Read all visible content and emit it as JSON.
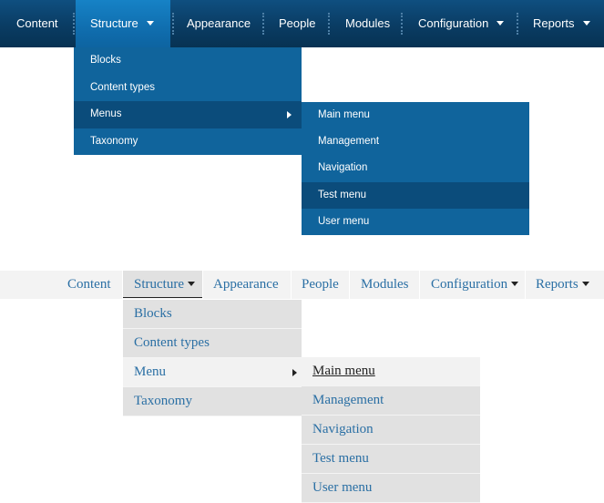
{
  "colors": {
    "top_bar": "#0a3c63",
    "top_active": "#1274b8",
    "top_dropdown": "#10649c",
    "top_dropdown_highlight": "#0b4c7b",
    "bottom_bar": "#f3f3f3",
    "bottom_dropdown": "#e1e1e1",
    "bottom_link": "#2a6fa4"
  },
  "top_menu": {
    "items": [
      {
        "label": "Content"
      },
      {
        "label": "Structure"
      },
      {
        "label": "Appearance"
      },
      {
        "label": "People"
      },
      {
        "label": "Modules"
      },
      {
        "label": "Configuration"
      },
      {
        "label": "Reports"
      }
    ],
    "structure_submenu": [
      "Blocks",
      "Content types",
      "Menus",
      "Taxonomy"
    ],
    "menus_submenu": [
      "Main menu",
      "Management",
      "Navigation",
      "Test menu",
      "User menu"
    ]
  },
  "bottom_menu": {
    "items": [
      {
        "label": "Content"
      },
      {
        "label": "Structure"
      },
      {
        "label": "Appearance"
      },
      {
        "label": "People"
      },
      {
        "label": "Modules"
      },
      {
        "label": "Configuration"
      },
      {
        "label": "Reports"
      }
    ],
    "structure_submenu": [
      "Blocks",
      "Content types",
      "Menu",
      "Taxonomy"
    ],
    "menu_submenu": [
      "Main menu",
      "Management",
      "Navigation",
      "Test menu",
      "User menu"
    ]
  }
}
